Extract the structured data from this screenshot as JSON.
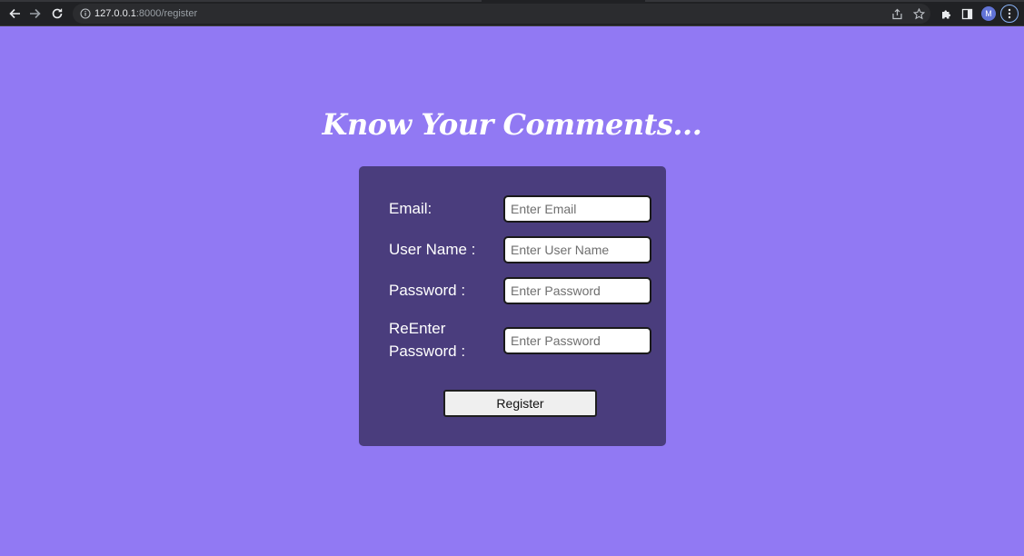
{
  "browser": {
    "url_host": "127.0.0.1",
    "url_path": ":8000/register",
    "profile_initial": "M",
    "icons": {
      "back": "back-arrow-icon",
      "forward": "forward-arrow-icon",
      "reload": "reload-icon",
      "site_info": "info-icon",
      "share": "share-icon",
      "bookmark": "star-icon",
      "extensions": "puzzle-icon",
      "side_panel": "side-panel-icon",
      "menu": "kebab-menu-icon"
    }
  },
  "page": {
    "title": "Know Your Comments...",
    "background_color": "#9179f3",
    "card_color": "#4a3d7d"
  },
  "form": {
    "email": {
      "label": "Email:",
      "placeholder": "Enter Email",
      "value": ""
    },
    "username": {
      "label": "User Name :",
      "placeholder": "Enter User Name",
      "value": ""
    },
    "password": {
      "label": "Password :",
      "placeholder": "Enter Password",
      "value": ""
    },
    "confirm_password": {
      "label": "ReEnter Password :",
      "placeholder": "Enter Password",
      "value": ""
    },
    "submit_label": "Register"
  }
}
